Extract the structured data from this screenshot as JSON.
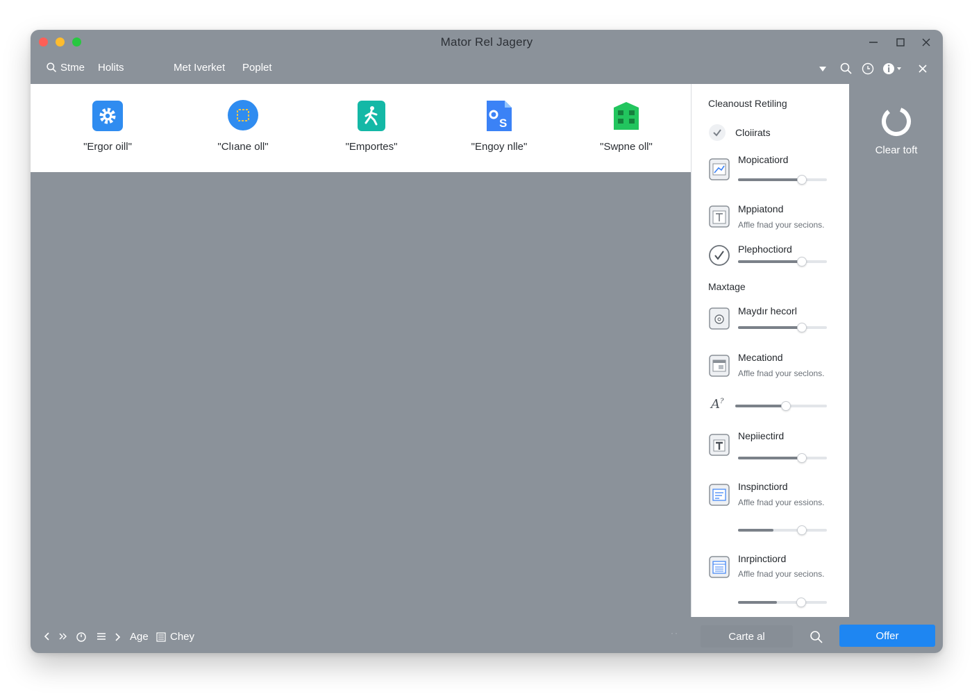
{
  "window": {
    "title": "Mator Rel Jagery"
  },
  "toolbar": {
    "search_label": "Stme",
    "item_holits": "Holits",
    "item_met": "Met Iverket",
    "item_poplet": "Poplet"
  },
  "apps": [
    {
      "label": "\"Ergor oill\"",
      "icon": "gear-icon",
      "color": "#2f8cf0"
    },
    {
      "label": "\"Clıane oll\"",
      "icon": "chat-bubble-icon",
      "color": "#2f8cf0"
    },
    {
      "label": "\"Emportes\"",
      "icon": "person-walking-icon",
      "color": "#14b8a6"
    },
    {
      "label": "\"Engoy nlle\"",
      "icon": "document-os-icon",
      "color": "#3b82f6"
    },
    {
      "label": "\"Swpne oll\"",
      "icon": "building-icon",
      "color": "#22c55e"
    }
  ],
  "side_panel": {
    "heading": "Cleanoust Retiling",
    "check_label": "Cloiirats",
    "section_heading": "Maxtage",
    "rows": [
      {
        "title": "Mopicatiord",
        "desc": "",
        "slider": 0.72
      },
      {
        "title": "Mppiatond",
        "desc": "Affle fnad your secions.",
        "slider": null
      },
      {
        "title": "Plephoctiord",
        "desc": "",
        "slider": 0.72
      },
      {
        "title": "Maydır hecorl",
        "desc": "",
        "slider": 0.72
      },
      {
        "title": "Mecationd",
        "desc": "Affle fnad your seclons.",
        "slider": null
      },
      {
        "title": "",
        "desc": "",
        "slider": 0.6
      },
      {
        "title": "Nepiiectird",
        "desc": "",
        "slider": 0.72
      },
      {
        "title": "Inspinctiord",
        "desc": "Affle fnad your essions.",
        "slider": 0.4
      },
      {
        "title": "Inrpinctiord",
        "desc": "Affle fnad your secions.",
        "slider": 0.44
      }
    ]
  },
  "clear": {
    "label": "Clear toft"
  },
  "bottombar": {
    "age_label": "Age",
    "chey_label": "Chey",
    "cancel_label": "Carte al",
    "offer_label": "Offer"
  },
  "colors": {
    "window_bg": "#8b929a",
    "accent": "#1e86f2"
  }
}
